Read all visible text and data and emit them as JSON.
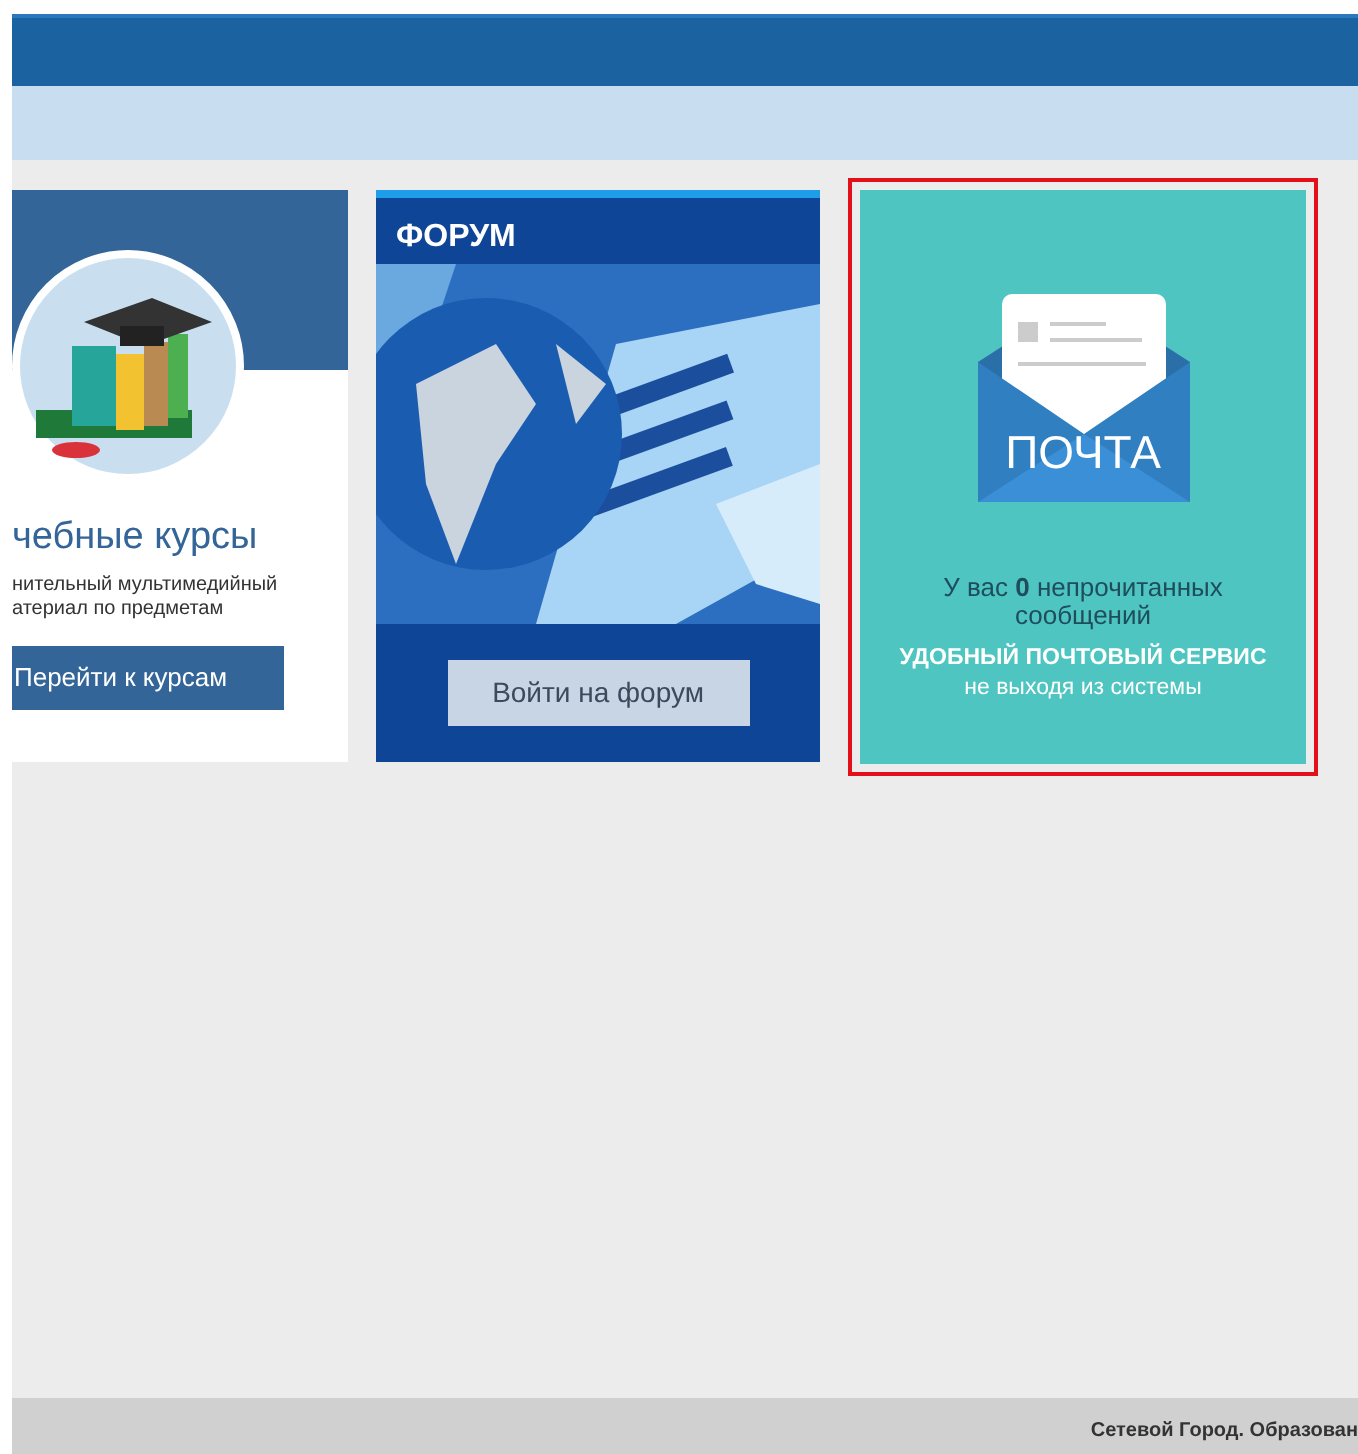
{
  "courses_card": {
    "title": "чебные курсы",
    "description": "нительный мультимедийный\nатериал по предметам",
    "button": "Перейти к курсам"
  },
  "forum_card": {
    "title": "ФОРУМ",
    "button": "Войти на форум"
  },
  "mail_card": {
    "highlighted": true,
    "logo_text": "ПОЧТА",
    "unread": "У вас **0** непрочитанных сообщений",
    "slogan": "УДОБНЫЙ ПОЧТОВЫЙ СЕРВИС",
    "subtitle": "не выходя из системы"
  },
  "footer": {
    "text": "Сетевой Город. Образован"
  }
}
